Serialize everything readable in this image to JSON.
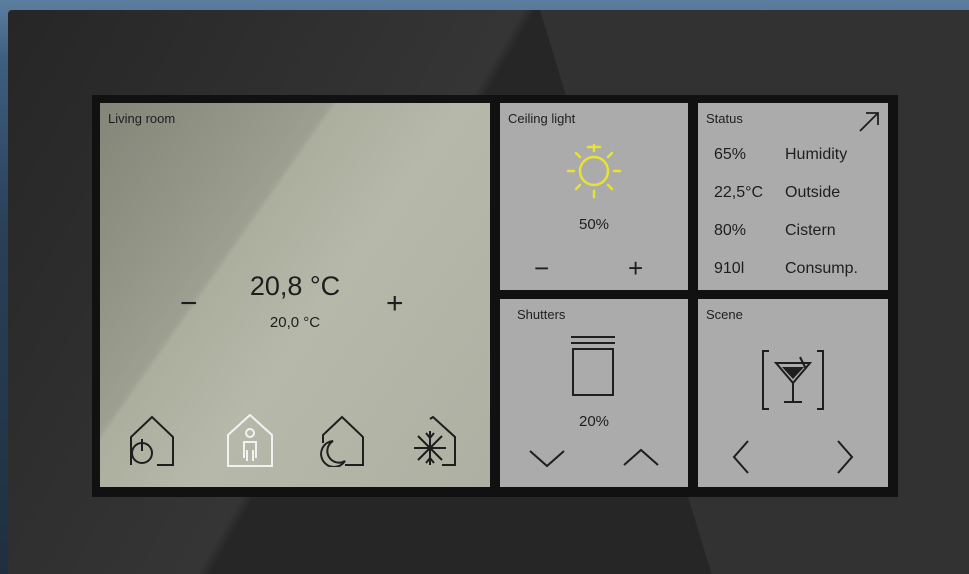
{
  "living_room": {
    "title": "Living room",
    "current_temp": "20,8 °C",
    "setpoint": "20,0 °C",
    "minus": "−",
    "plus": "+",
    "modes": [
      "house-power-icon",
      "house-person-icon",
      "house-moon-icon",
      "house-snowflake-icon"
    ]
  },
  "ceiling_light": {
    "title": "Ceiling light",
    "level": "50%",
    "minus": "−",
    "plus": "+",
    "icon": "sun-icon",
    "icon_color": "#e8e233"
  },
  "status": {
    "title": "Status",
    "rows": [
      {
        "value": "65%",
        "label": "Humidity"
      },
      {
        "value": "22,5°C",
        "label": "Outside"
      },
      {
        "value": "80%",
        "label": "Cistern"
      },
      {
        "value": "910l",
        "label": "Consump."
      }
    ]
  },
  "shutters": {
    "title": "Shutters",
    "level": "20%"
  },
  "scene": {
    "title": "Scene",
    "icon": "cocktail-icon"
  },
  "colors": {
    "tile": "#ababab",
    "text": "#1e1e1e",
    "active_mode": "#f2f2f2"
  }
}
